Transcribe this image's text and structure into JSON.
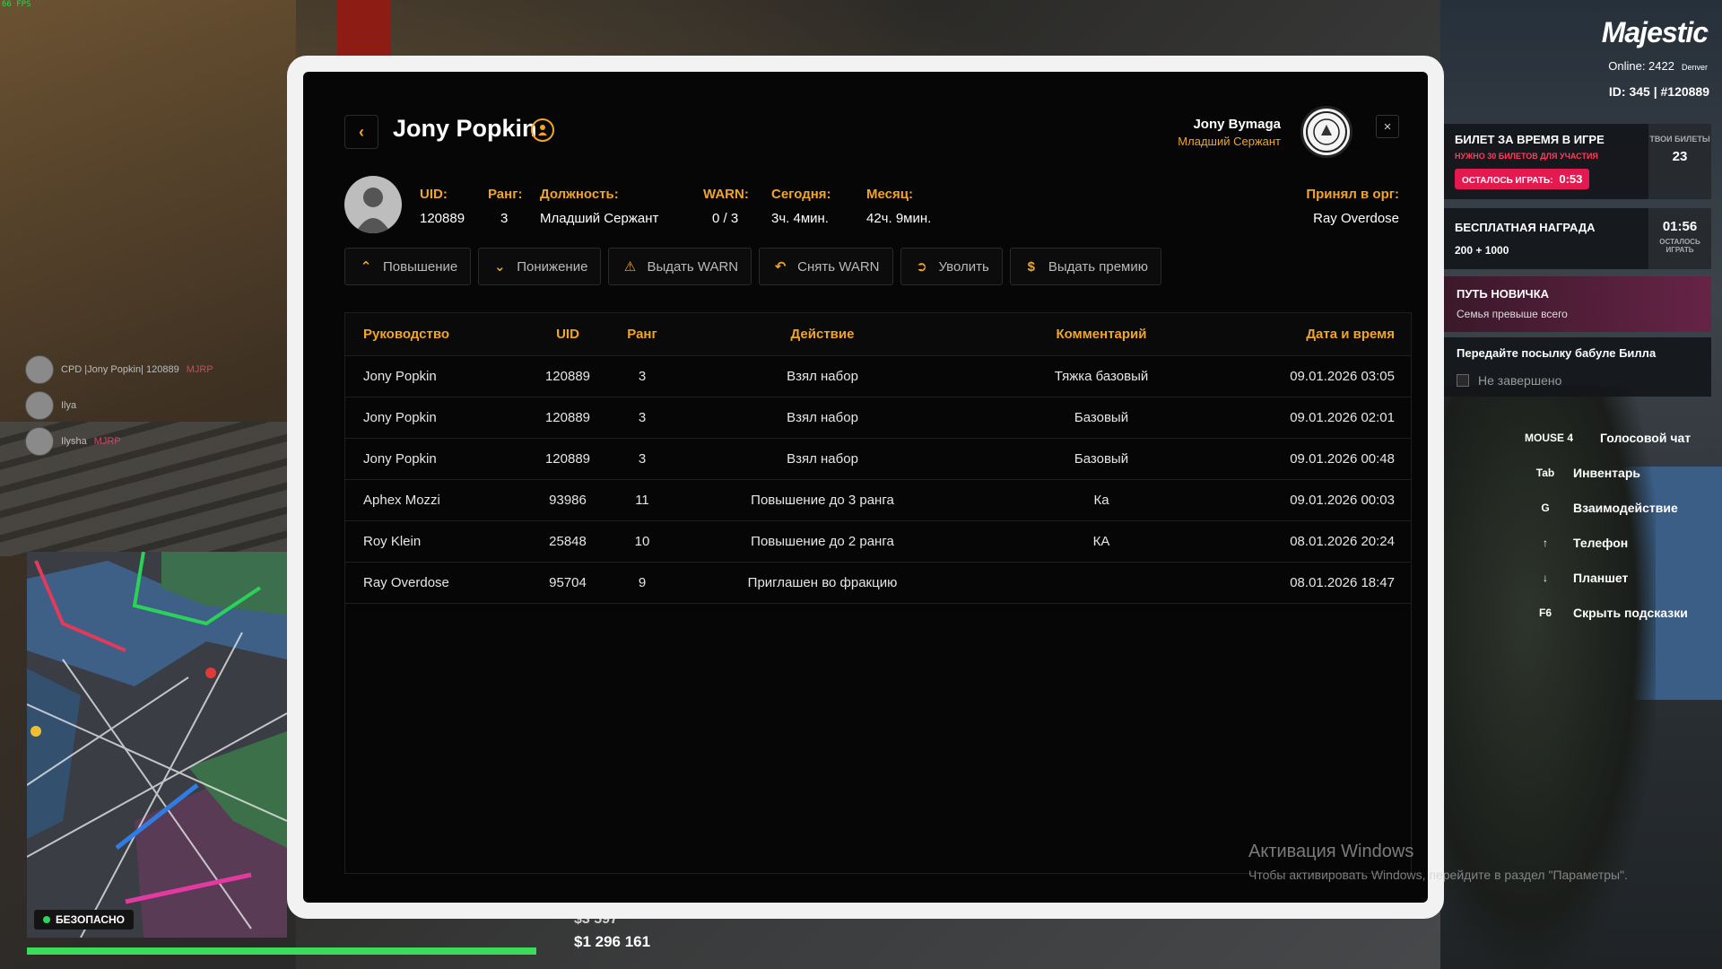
{
  "hud": {
    "fps": "66 FPS",
    "brand": "Majestic",
    "online_label": "Online: 2422",
    "server": "Denver",
    "id_line": "ID: 345 | #120889",
    "voice": [
      {
        "name": "CPD |Jony Popkin| 120889",
        "tag": "MJRP"
      },
      {
        "name": "Ilya",
        "tag": ""
      },
      {
        "name": "Ilysha",
        "tag": "MJRP"
      }
    ],
    "safe_zone": "БЕЗОПАСНО",
    "health_percent": 100,
    "bank_money": "$3 597",
    "cash_money": "$1 296 161"
  },
  "quests": {
    "ticket": {
      "title": "БИЛЕТ ЗА ВРЕМЯ В ИГРЕ",
      "subtitle": "НУЖНО 30 БИЛЕТОВ ДЛЯ УЧАСТИЯ",
      "play_label": "ОСТАЛОСЬ ИГРАТЬ:",
      "play_time": "0:53",
      "tickets_label": "ТВОИ БИЛЕТЫ",
      "tickets_count": "23"
    },
    "free_reward": {
      "title": "БЕСПЛАТНАЯ НАГРАДА",
      "reward": "200 + 1000",
      "timer": "01:56",
      "timer_label": "ОСТАЛОСЬ ИГРАТЬ"
    },
    "newbie": {
      "title": "ПУТЬ НОВИЧКА",
      "subtitle": "Семья превыше всего"
    },
    "task": {
      "title": "Передайте посылку бабуле Билла",
      "status": "Не завершено"
    }
  },
  "hints": [
    {
      "key": "MOUSE 4",
      "label": "Голосовой чат"
    },
    {
      "key": "Tab",
      "label": "Инвентарь"
    },
    {
      "key": "G",
      "label": "Взаимодействие"
    },
    {
      "key": "↑",
      "label": "Телефон"
    },
    {
      "key": "↓",
      "label": "Планшет"
    },
    {
      "key": "F6",
      "label": "Скрыть подсказки"
    }
  ],
  "windows": {
    "title": "Активация Windows",
    "subtitle": "Чтобы активировать Windows, перейдите в раздел \"Параметры\"."
  },
  "panel": {
    "name": "Jony Popkin",
    "viewer_name": "Jony Bymaga",
    "viewer_rank": "Младший Сержант",
    "info": {
      "uid_label": "UID:",
      "uid": "120889",
      "rank_label": "Ранг:",
      "rank": "3",
      "position_label": "Должность:",
      "position": "Младший Сержант",
      "warn_label": "WARN:",
      "warn": "0 / 3",
      "today_label": "Сегодня:",
      "today": "3ч. 4мин.",
      "month_label": "Месяц:",
      "month": "42ч. 9мин.",
      "hired_label": "Принял в орг:",
      "hired_by": "Ray Overdose"
    },
    "actions": {
      "promote": "Повышение",
      "demote": "Понижение",
      "give_warn": "Выдать WARN",
      "remove_warn": "Снять WARN",
      "fire": "Уволить",
      "bonus": "Выдать премию"
    },
    "table": {
      "headers": [
        "Руководство",
        "UID",
        "Ранг",
        "Действие",
        "Комментарий",
        "Дата и время"
      ],
      "rows": [
        [
          "Jony Popkin",
          "120889",
          "3",
          "Взял набор",
          "Тяжка базовый",
          "09.01.2026 03:05"
        ],
        [
          "Jony Popkin",
          "120889",
          "3",
          "Взял набор",
          "Базовый",
          "09.01.2026 02:01"
        ],
        [
          "Jony Popkin",
          "120889",
          "3",
          "Взял набор",
          "Базовый",
          "09.01.2026 00:48"
        ],
        [
          "Aphex Mozzi",
          "93986",
          "11",
          "Повышение до 3 ранга",
          "Ка",
          "09.01.2026 00:03"
        ],
        [
          "Roy Klein",
          "25848",
          "10",
          "Повышение до 2 ранга",
          "КА",
          "08.01.2026 20:24"
        ],
        [
          "Ray Overdose",
          "95704",
          "9",
          "Приглашен во фракцию",
          "",
          "08.01.2026 18:47"
        ]
      ]
    }
  }
}
